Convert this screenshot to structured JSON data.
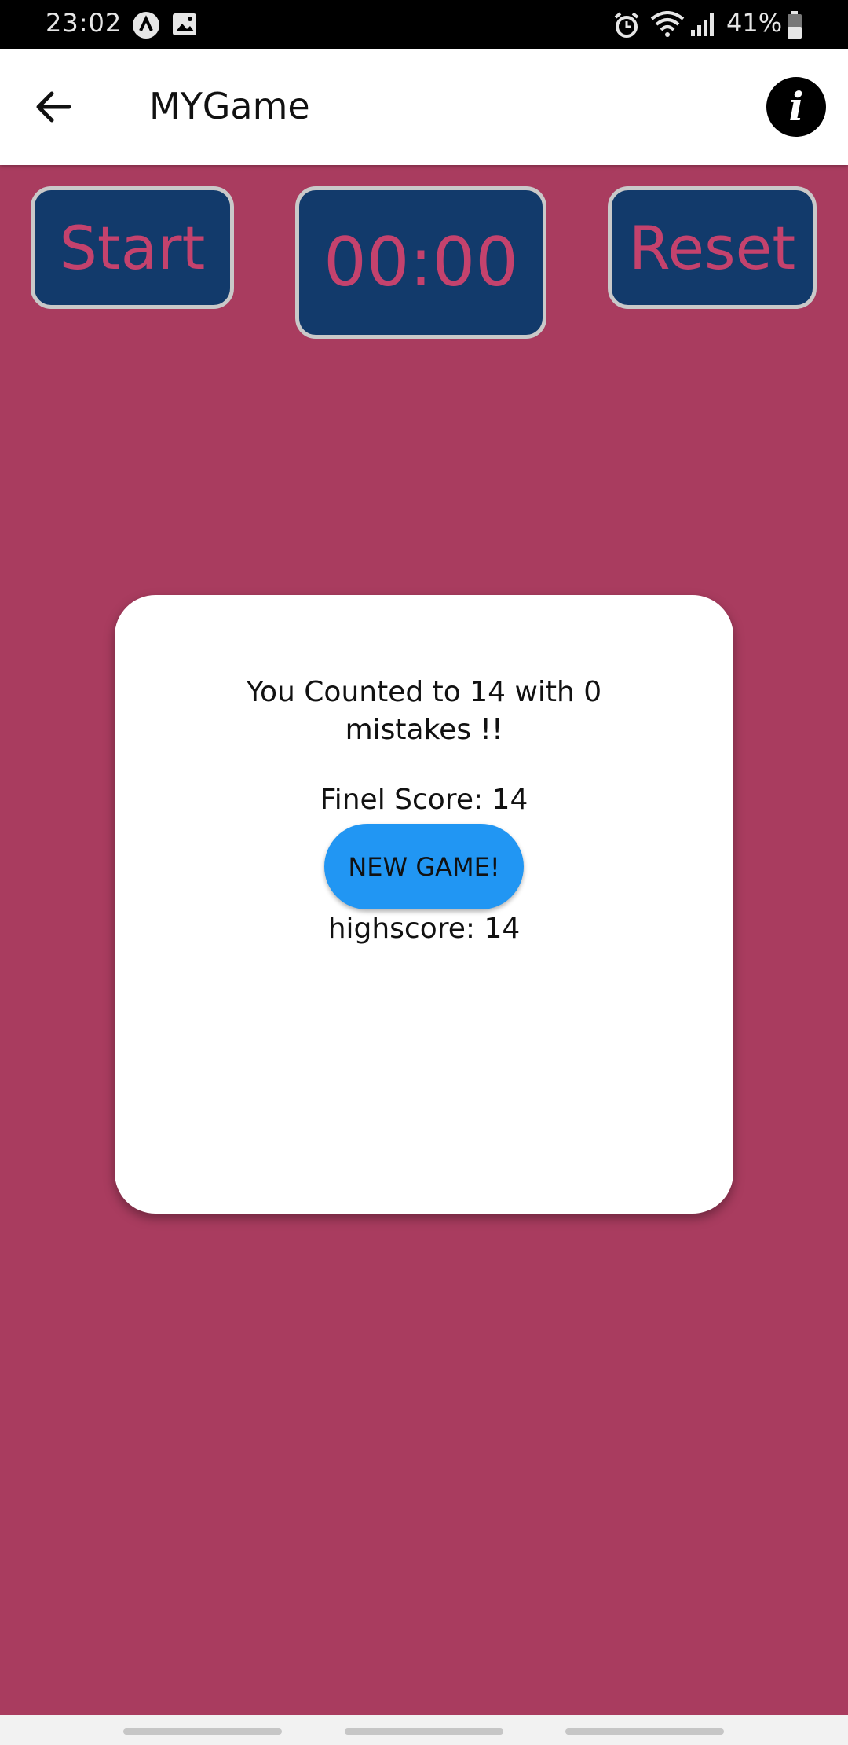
{
  "status_bar": {
    "time": "23:02",
    "battery": "41%",
    "icons": [
      "notification-a-icon",
      "image-icon",
      "alarm-icon",
      "wifi-icon",
      "signal-icon",
      "battery-icon"
    ]
  },
  "app_bar": {
    "title": "MYGame",
    "back_icon": "arrow-left-icon",
    "info_label": "i"
  },
  "controls": {
    "start_label": "Start",
    "timer": "00:00",
    "reset_label": "Reset"
  },
  "dialog": {
    "message": "You Counted to 14 with 0 mistakes !!",
    "final_score": "Finel Score: 14",
    "new_game_label": "NEW GAME!",
    "highscore": "highscore: 14"
  },
  "colors": {
    "background": "#a93c5f",
    "button_fill": "#123a6b",
    "button_text": "#c4426d",
    "accent": "#2196f3"
  }
}
